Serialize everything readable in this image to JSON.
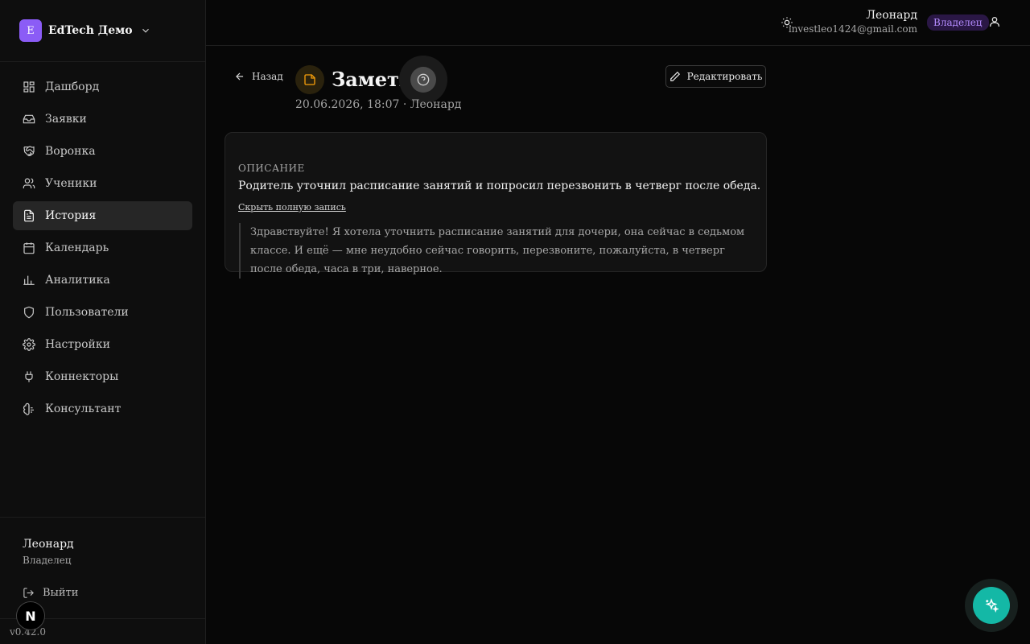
{
  "brand": {
    "logo_letter": "E",
    "name": "EdTech Демо"
  },
  "sidebar": {
    "items": [
      {
        "label": "Дашборд",
        "icon": "dashboard-icon"
      },
      {
        "label": "Заявки",
        "icon": "inbox-icon"
      },
      {
        "label": "Воронка",
        "icon": "handshake-icon"
      },
      {
        "label": "Ученики",
        "icon": "users-icon"
      },
      {
        "label": "История",
        "icon": "file-text-icon",
        "active": true
      },
      {
        "label": "Календарь",
        "icon": "calendar-icon"
      },
      {
        "label": "Аналитика",
        "icon": "bar-chart-icon"
      },
      {
        "label": "Пользователи",
        "icon": "shield-icon"
      },
      {
        "label": "Настройки",
        "icon": "gear-icon"
      },
      {
        "label": "Коннекторы",
        "icon": "plug-icon"
      },
      {
        "label": "Консультант",
        "icon": "brain-icon"
      }
    ],
    "footer": {
      "user_name": "Леонард",
      "user_role": "Владелец",
      "logout_label": "Выйти",
      "version": "v0.42.0",
      "badge_letter": "N"
    }
  },
  "topbar": {
    "user_name": "Леонард",
    "user_email": "investleo1424@gmail.com",
    "role_badge": "Владелец"
  },
  "main": {
    "back_label": "Назад",
    "title": "Заметка",
    "meta": "20.06.2026, 18:07 · Леонард",
    "edit_label": "Редактировать",
    "card": {
      "section_label": "ОПИСАНИЕ",
      "description": "Родитель уточнил расписание занятий и попросил перезвонить в четверг после обеда.",
      "toggle_label": "Скрыть полную запись",
      "full_text": "Здравствуйте! Я хотела уточнить расписание занятий для дочери, она сейчас в седьмом классе. И ещё — мне неудобно сейчас говорить, перезвоните, пожалуйста, в четверг после обеда, часа в три, наверное."
    }
  },
  "colors": {
    "accent_purple": "#8b5cf6",
    "note_amber": "#f59e0b",
    "fab_teal": "#14b8a6",
    "owner_badge_text": "#b58cff"
  }
}
